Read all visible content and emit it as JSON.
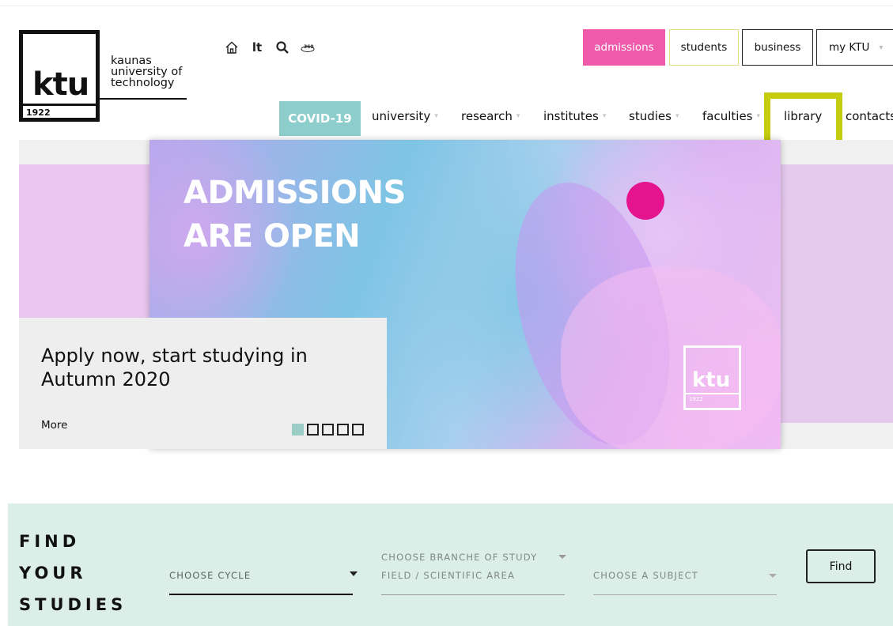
{
  "logo": {
    "mark": "ktu",
    "year": "1922",
    "name_lines": [
      "kaunas",
      "university of",
      "technology"
    ]
  },
  "utility_icons": [
    "home-icon",
    "language-switch",
    "search-icon",
    "360-view-icon"
  ],
  "language_label": "lt",
  "top_buttons": {
    "admissions": "admissions",
    "students": "students",
    "business": "business",
    "my_ktu": "my KTU"
  },
  "nav": {
    "covid": "COVID-19",
    "items": [
      {
        "label": "university",
        "has_dropdown": true
      },
      {
        "label": "research",
        "has_dropdown": true
      },
      {
        "label": "institutes",
        "has_dropdown": true
      },
      {
        "label": "studies",
        "has_dropdown": true
      },
      {
        "label": "faculties",
        "has_dropdown": true
      },
      {
        "label": "library",
        "has_dropdown": false,
        "highlighted": true
      },
      {
        "label": "contacts",
        "has_dropdown": false
      }
    ]
  },
  "hero": {
    "headline_lines": [
      "ADMISSIONS",
      "ARE OPEN"
    ],
    "logo_mark": "ktu",
    "logo_year": "1922",
    "card_title": "Apply now, start studying in Autumn 2020",
    "card_link": "More",
    "slides_total": 5,
    "slide_active": 1
  },
  "find_studies": {
    "title_lines": [
      "FIND",
      "YOUR",
      "STUDIES"
    ],
    "cycle_placeholder": "CHOOSE CYCLE",
    "branch_line1": "CHOOSE BRANCHE OF STUDY",
    "branch_line2": "FIELD / SCIENTIFIC AREA",
    "subject_placeholder": "CHOOSE A SUBJECT",
    "button": "Find"
  },
  "colors": {
    "admissions_pink": "#f05aaa",
    "covid_teal": "#8dcdcb",
    "highlight_yellow": "#c6cc10",
    "find_bg": "#dbeee8",
    "hero_dot_magenta": "#e5138e"
  }
}
